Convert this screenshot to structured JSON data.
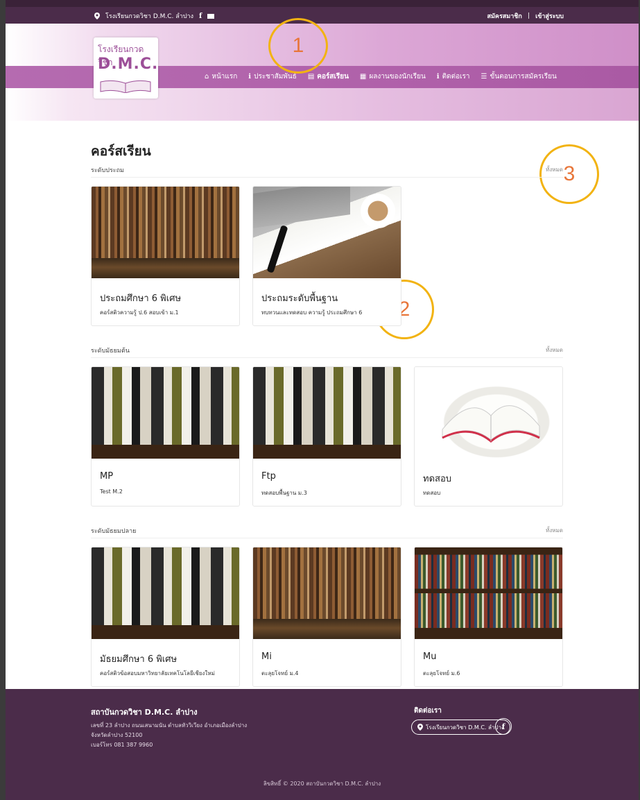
{
  "topbar": {
    "school": "โรงเรียนกวดวิชา D.M.C. ลำปาง",
    "register": "สมัครสมาชิก",
    "separator": "|",
    "login": "เข้าสู่ระบบ"
  },
  "logo": {
    "line1": "โรงเรียนกวดวิชา",
    "line2": "D.M.C."
  },
  "nav": [
    {
      "label": "หน้าแรก",
      "icon": "home-icon"
    },
    {
      "label": "ประชาสัมพันธ์",
      "icon": "info-icon"
    },
    {
      "label": "คอร์สเรียน",
      "icon": "book-icon"
    },
    {
      "label": "ผลงานของนักเรียน",
      "icon": "newspaper-icon"
    },
    {
      "label": "ติดต่อเรา",
      "icon": "info-icon"
    },
    {
      "label": "ขั้นตอนการสมัครเรียน",
      "icon": "list-icon"
    }
  ],
  "annotations": [
    "1",
    "2",
    "3"
  ],
  "page_title": "คอร์สเรียน",
  "sections": [
    {
      "heading": "ระดับประถม",
      "all_link": "ทั้งหมด",
      "courses": [
        {
          "title": "ประถมศึกษา 6 พิเศษ",
          "subtitle": "คอร์สติวความรู้ ป.6 สอบเข้า ม.1"
        },
        {
          "title": "ประถมระดับพื้นฐาน",
          "subtitle": "ทบทวนและทดสอบ ความรู้ ประถมศึกษา 6"
        }
      ]
    },
    {
      "heading": "ระดับมัธยมต้น",
      "all_link": "ทั้งหมด",
      "courses": [
        {
          "title": "MP",
          "subtitle": "Test M.2"
        },
        {
          "title": "Ftp",
          "subtitle": "ทดสอบพื้นฐาน ม.3"
        },
        {
          "title": "ทดสอบ",
          "subtitle": "ทดสอบ"
        }
      ]
    },
    {
      "heading": "ระดับมัธยมปลาย",
      "all_link": "ทั้งหมด",
      "courses": [
        {
          "title": "มัธยมศึกษา 6 พิเศษ",
          "subtitle": "คอร์สติวข้อสอบมหาวิทยาลัยเทคโนโลยีเชียงใหม่"
        },
        {
          "title": "Mi",
          "subtitle": "ตะลุยโจทย์ ม.4"
        },
        {
          "title": "Mu",
          "subtitle": "ตะลุยโจทย์ ม.6"
        }
      ]
    }
  ],
  "footer": {
    "school": "สถาบันกวดวิชา D.M.C. ลำปาง",
    "address_lines": [
      "เลขที่ 23 ลำปาง ถนนเสนามนัน ตำบลหัววิเวียง อำเภอเมืองลำปาง",
      "จังหวัดลำปาง 52100",
      "เบอร์โทร 081 387 9960"
    ],
    "contact_heading": "ติดต่อเรา",
    "contact_pill": "โรงเรียนกวดวิชา D.M.C. ลำปาง",
    "copyright": "ลิขสิทธิ์ © 2020 สถาบันกวดวิชา D.M.C. ลำปาง"
  },
  "colors": {
    "brand": "#b061aa",
    "dark": "#4b2c4a",
    "annotation": "#f2b312"
  }
}
